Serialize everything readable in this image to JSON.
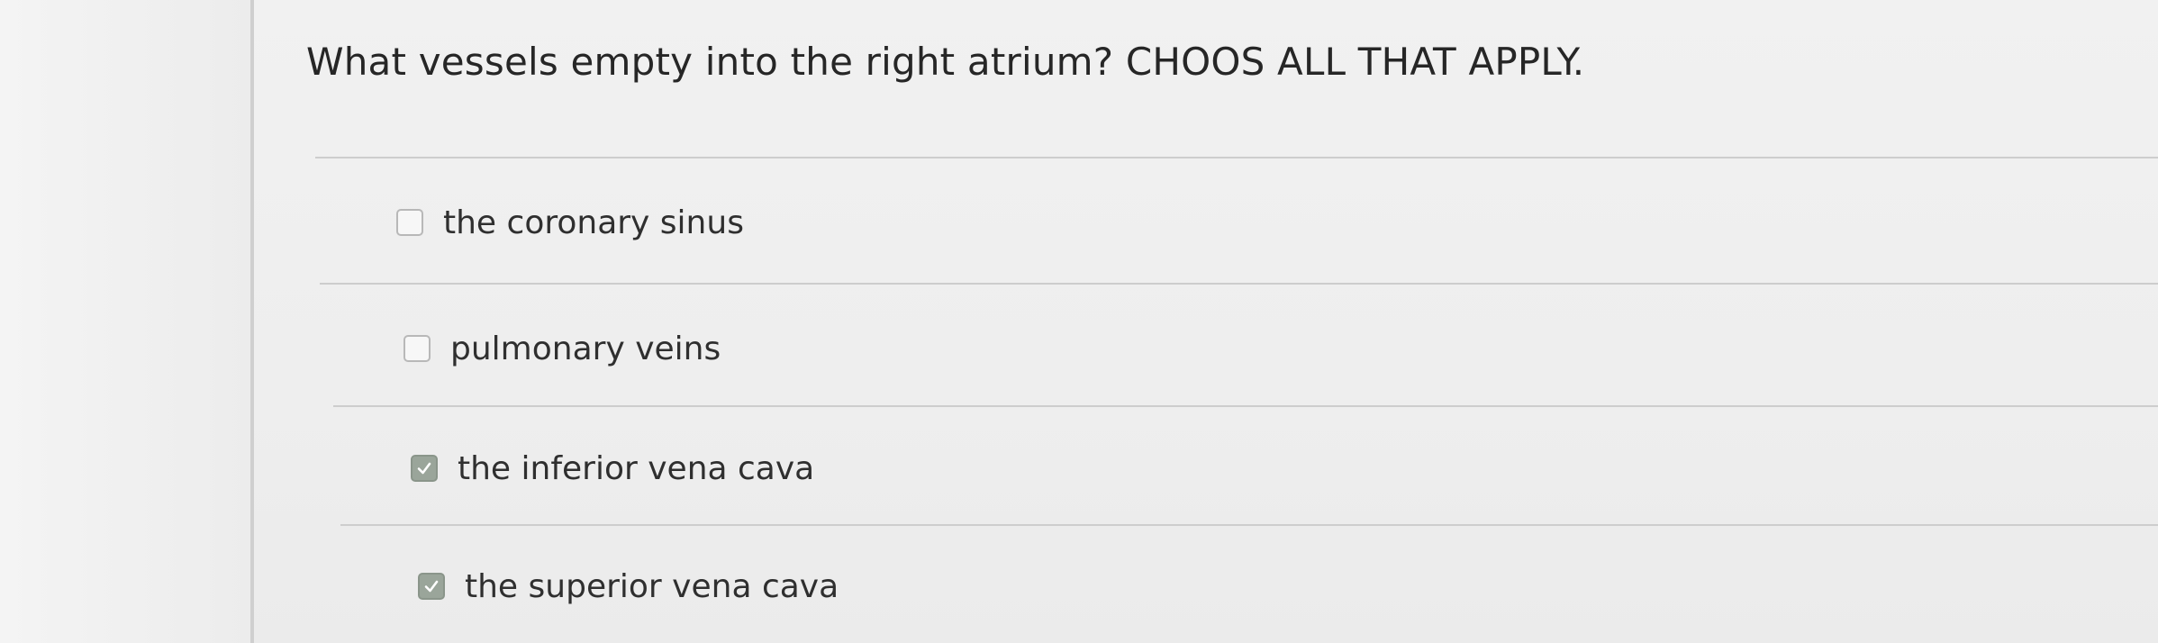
{
  "question": {
    "text": "What vessels empty into the right atrium?  CHOOS ALL THAT APPLY."
  },
  "options": [
    {
      "label": "the coronary sinus",
      "checked": false
    },
    {
      "label": "pulmonary veins",
      "checked": false
    },
    {
      "label": "the inferior vena cava",
      "checked": true
    },
    {
      "label": "the superior vena cava",
      "checked": true
    }
  ],
  "colors": {
    "checked_box": "#9aa59a",
    "unchecked_border": "#b8b8b8",
    "text": "#262626"
  }
}
